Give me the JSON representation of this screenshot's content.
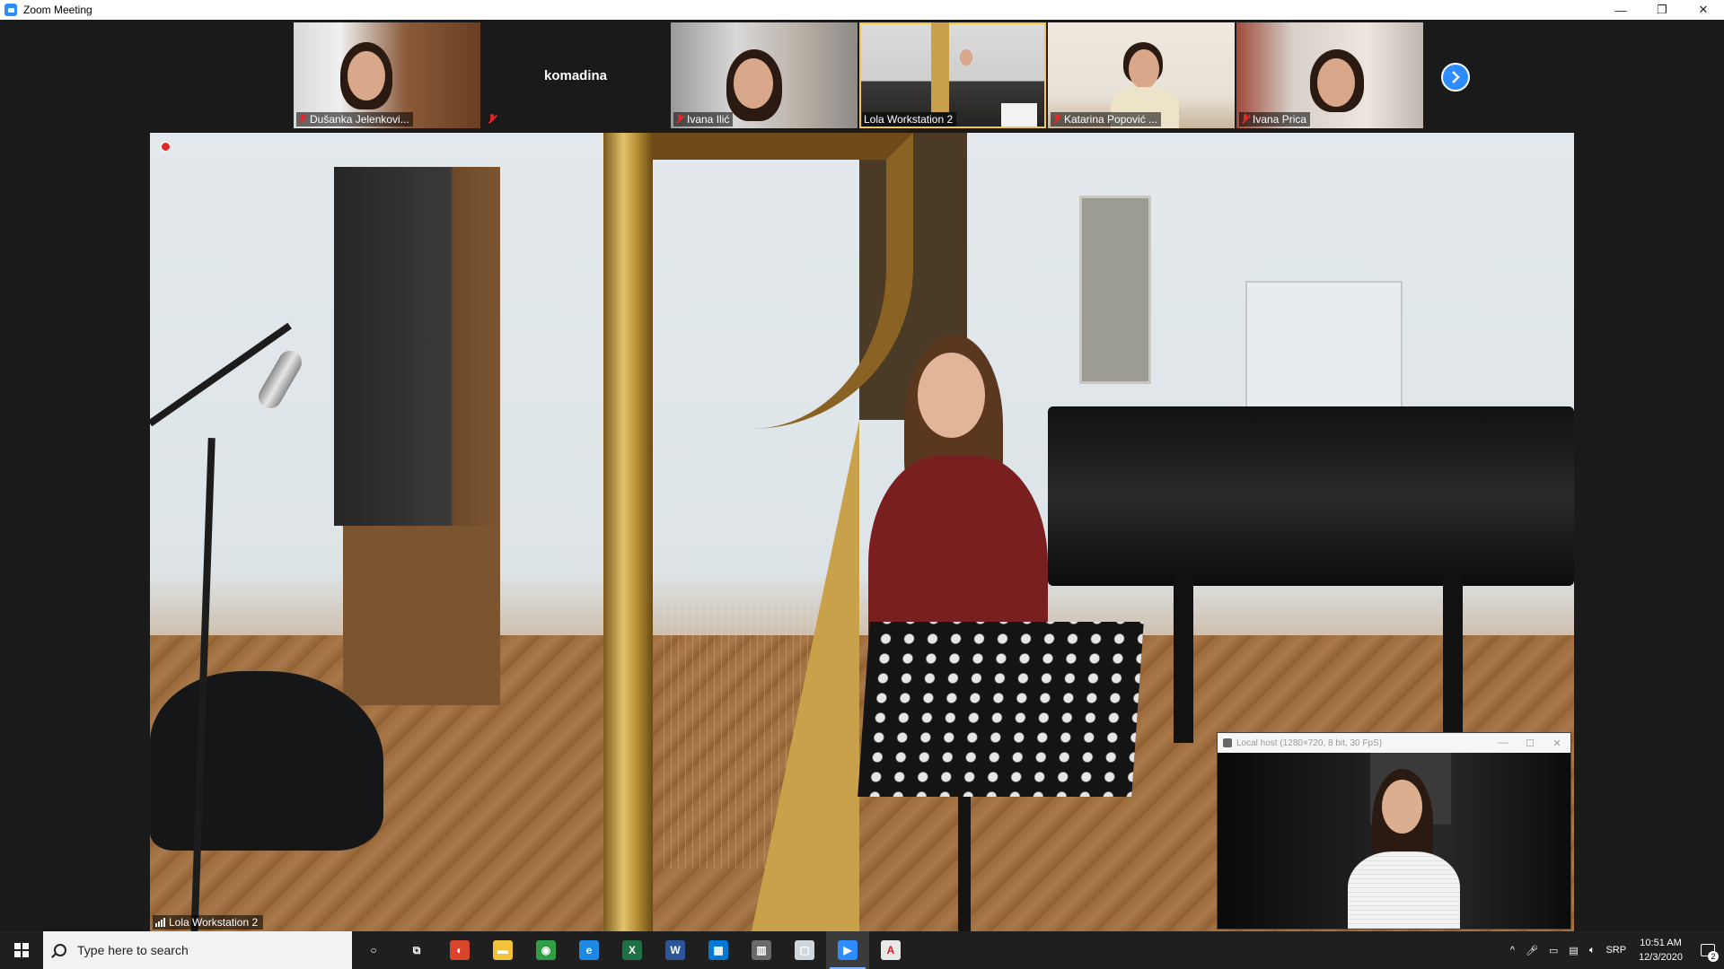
{
  "window": {
    "title": "Zoom Meeting",
    "minimize": "—",
    "restore": "❐",
    "close": "✕"
  },
  "participants": [
    {
      "name": "Dušanka Jelenkovi...",
      "video": true,
      "muted": true
    },
    {
      "name": "komadina",
      "video": false,
      "muted": true
    },
    {
      "name": "Ivana Ilić",
      "video": true,
      "muted": true
    },
    {
      "name": "Lola Workstation 2",
      "video": true,
      "muted": false,
      "active": true
    },
    {
      "name": "Katarina Popović ...",
      "video": true,
      "muted": true
    },
    {
      "name": "Ivana Prica",
      "video": true,
      "muted": true
    }
  ],
  "main_video": {
    "name": "Lola Workstation 2"
  },
  "local_window": {
    "title": "Local host (1280×720, 8 bit, 30 FpS)",
    "minimize": "—",
    "maximize": "☐",
    "close": "✕"
  },
  "taskbar": {
    "search_placeholder": "Type here to search",
    "apps": [
      {
        "name": "cortana",
        "label": "○",
        "color": "transparent"
      },
      {
        "name": "task-view",
        "label": "⧉",
        "color": "transparent"
      },
      {
        "name": "chrome-alt",
        "label": "◐",
        "color": "#d9452b"
      },
      {
        "name": "file-explorer",
        "label": "▬",
        "color": "#f1c23b"
      },
      {
        "name": "chrome",
        "label": "◉",
        "color": "#2f9e44"
      },
      {
        "name": "edge",
        "label": "e",
        "color": "#1e88e5"
      },
      {
        "name": "excel",
        "label": "X",
        "color": "#1e7145"
      },
      {
        "name": "word",
        "label": "W",
        "color": "#2b579a"
      },
      {
        "name": "store",
        "label": "▦",
        "color": "#0078d4"
      },
      {
        "name": "app-generic",
        "label": "▥",
        "color": "#6a6a6a"
      },
      {
        "name": "app-white",
        "label": "▢",
        "color": "#cfd6dc"
      },
      {
        "name": "zoom",
        "label": "▶",
        "color": "#2d8cff",
        "active": true
      },
      {
        "name": "acrobat",
        "label": "A",
        "color": "#e8e8e8"
      }
    ],
    "tray": {
      "chevron": "^",
      "language": "SRP",
      "time": "10:51 AM",
      "date": "12/3/2020",
      "notifications": "2"
    }
  }
}
